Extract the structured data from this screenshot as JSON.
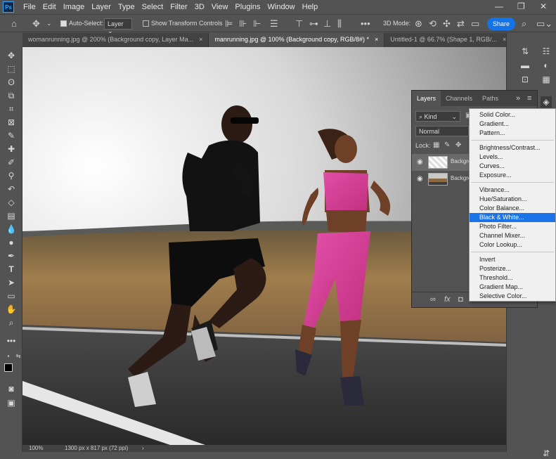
{
  "app": {
    "logo": "Ps"
  },
  "menubar": [
    "File",
    "Edit",
    "Image",
    "Layer",
    "Type",
    "Select",
    "Filter",
    "3D",
    "View",
    "Plugins",
    "Window",
    "Help"
  ],
  "window_controls": {
    "minimize": "—",
    "restore": "❐",
    "close": "✕"
  },
  "options_bar": {
    "auto_select_label": "Auto-Select:",
    "auto_select_value": "Layer",
    "show_transform_label": "Show Transform Controls",
    "mode_3d_label": "3D Mode:",
    "share_label": "Share",
    "more": "•••"
  },
  "tabs": [
    {
      "label": "womanrunning.jpg @ 200% (Background copy, Layer Ma...",
      "close": "×"
    },
    {
      "label": "manrunning.jpg @ 100% (Background copy, RGB/8#) *",
      "close": "×"
    },
    {
      "label": "Untitled-1 @ 66.7% (Shape 1, RGB/...",
      "close": "×"
    }
  ],
  "active_tab": 1,
  "status": {
    "zoom": "100%",
    "info": "1300 px x 817 px (72 ppi)",
    "arrow": "›"
  },
  "layers_panel": {
    "tabs": [
      "Layers",
      "Channels",
      "Paths"
    ],
    "active_tab": 0,
    "filter_kind": "Kind",
    "blend_mode": "Normal",
    "lock_label": "Lock:",
    "layers": [
      {
        "name": "Background copy",
        "selected": true
      },
      {
        "name": "Background",
        "selected": false
      }
    ]
  },
  "adjustment_menu": {
    "groups": [
      [
        "Solid Color...",
        "Gradient...",
        "Pattern..."
      ],
      [
        "Brightness/Contrast...",
        "Levels...",
        "Curves...",
        "Exposure..."
      ],
      [
        "Vibrance...",
        "Hue/Saturation...",
        "Color Balance...",
        "Black & White...",
        "Photo Filter...",
        "Channel Mixer...",
        "Color Lookup..."
      ],
      [
        "Invert",
        "Posterize...",
        "Threshold...",
        "Gradient Map...",
        "Selective Color..."
      ]
    ],
    "highlighted": "Black & White..."
  },
  "colors": {
    "accent": "#1473e6",
    "menu_highlight": "#1a73e8",
    "panel_bg": "#535353"
  }
}
